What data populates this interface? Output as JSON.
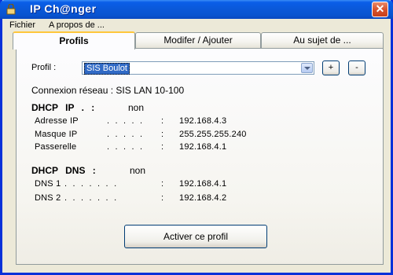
{
  "window": {
    "title": "IP Ch@nger",
    "close_label": "✕"
  },
  "menu": {
    "items": [
      "Fichier",
      "A propos de ..."
    ]
  },
  "tabs": [
    {
      "label": "Profils",
      "active": true
    },
    {
      "label": "Modifer / Ajouter",
      "active": false
    },
    {
      "label": "Au sujet de ...",
      "active": false
    }
  ],
  "profile": {
    "label": "Profil :",
    "selected": "SIS Boulot",
    "add_label": "+",
    "remove_label": "-"
  },
  "connection": {
    "text": "Connexion réseau : SIS LAN 10-100"
  },
  "dhcp_ip": {
    "heading": "DHCP IP . :",
    "value": "non",
    "rows": [
      {
        "label": "Adresse IP",
        "dots": ". . . . .",
        "colon": ":",
        "value": "192.168.4.3"
      },
      {
        "label": "Masque IP",
        "dots": ". . . . .",
        "colon": ":",
        "value": "255.255.255.240"
      },
      {
        "label": "Passerelle",
        "dots": ". . . . .",
        "colon": ":",
        "value": "192.168.4.1"
      }
    ]
  },
  "dhcp_dns": {
    "heading": "DHCP DNS :",
    "value": "non",
    "rows": [
      {
        "label": "DNS 1",
        "dots": ". . . . . . .",
        "colon": ":",
        "value": "192.168.4.1"
      },
      {
        "label": "DNS 2",
        "dots": ". . . . . . .",
        "colon": ":",
        "value": "192.168.4.2"
      }
    ]
  },
  "actions": {
    "activate_label": "Activer ce profil"
  },
  "colors": {
    "titlebar": "#0a58d8",
    "selection": "#316ac5",
    "tab_highlight": "#ffc73c",
    "face": "#ece9d8"
  }
}
